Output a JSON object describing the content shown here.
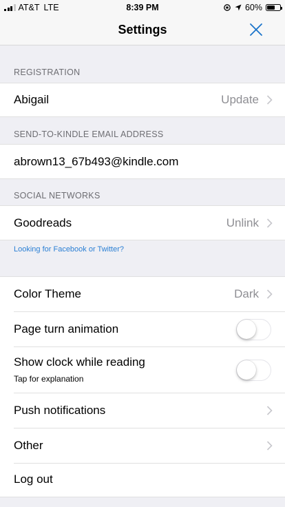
{
  "status_bar": {
    "carrier": "AT&T",
    "network": "LTE",
    "time": "8:39 PM",
    "battery": "60%",
    "battery_level": 0.6
  },
  "nav": {
    "title": "Settings",
    "close_icon": "close-icon"
  },
  "registration": {
    "header": "REGISTRATION",
    "name": "Abigail",
    "action": "Update"
  },
  "kindle": {
    "header": "SEND-TO-KINDLE EMAIL ADDRESS",
    "email": "abrown13_67b493@kindle.com"
  },
  "social": {
    "header": "SOCIAL NETWORKS",
    "network": "Goodreads",
    "action": "Unlink",
    "link_note": "Looking for Facebook or Twitter?"
  },
  "options": {
    "color_theme_label": "Color Theme",
    "color_theme_value": "Dark",
    "page_turn_label": "Page turn animation",
    "page_turn_on": false,
    "clock_label": "Show clock while reading",
    "clock_sub": "Tap for explanation",
    "clock_on": false,
    "push_label": "Push notifications",
    "other_label": "Other",
    "logout_label": "Log out"
  },
  "colors": {
    "link": "#2a7fd4",
    "accent": "#1a73c9",
    "background": "#efeff4"
  }
}
